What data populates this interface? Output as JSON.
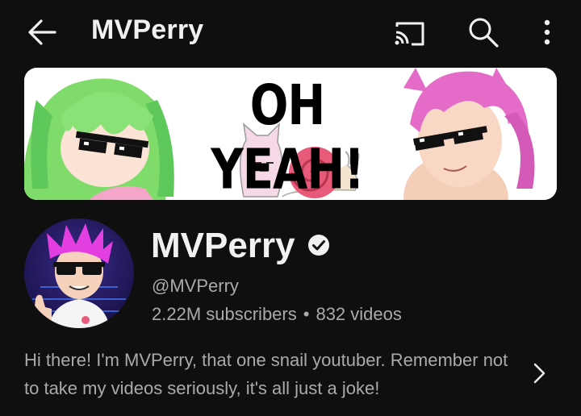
{
  "header": {
    "title": "MVPerry",
    "icons": [
      "back-arrow-icon",
      "cast-icon",
      "search-icon",
      "more-vert-icon"
    ]
  },
  "banner": {
    "text": "OH YEAH!"
  },
  "channel": {
    "name": "MVPerry",
    "verified": true,
    "handle": "@MVPerry",
    "subscribers": "2.22M subscribers",
    "separator": "•",
    "videos": "832 videos",
    "description": "Hi there! I'm MVPerry, that one snail youtuber. Remember not to take my videos seriously, it's all just a joke!"
  },
  "colors": {
    "background": "#0f0f0f",
    "primary_text": "#f1f1f1",
    "secondary_text": "#aaaaaa"
  }
}
